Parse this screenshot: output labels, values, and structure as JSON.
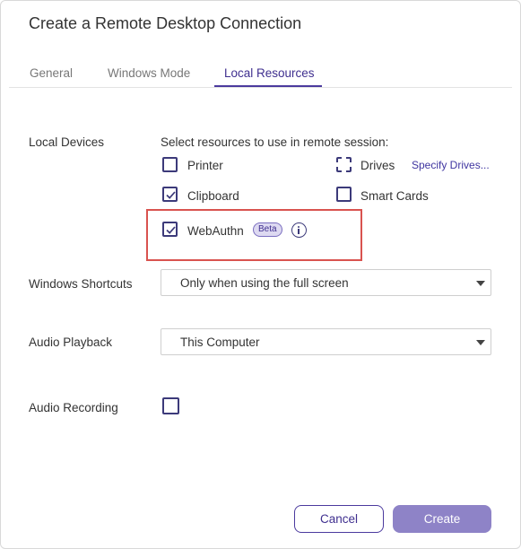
{
  "dialog": {
    "title": "Create a Remote Desktop Connection"
  },
  "tabs": [
    {
      "label": "General",
      "active": false
    },
    {
      "label": "Windows Mode",
      "active": false
    },
    {
      "label": "Local Resources",
      "active": true
    }
  ],
  "local_devices": {
    "label": "Local Devices",
    "instruction": "Select resources to use in remote session:",
    "options": {
      "printer": {
        "label": "Printer",
        "checked": false
      },
      "drives": {
        "label": "Drives",
        "checked": false,
        "link": "Specify Drives..."
      },
      "clipboard": {
        "label": "Clipboard",
        "checked": true
      },
      "smart_cards": {
        "label": "Smart Cards",
        "checked": false
      },
      "webauthn": {
        "label": "WebAuthn",
        "checked": true,
        "badge": "Beta",
        "icon": "info-icon"
      }
    }
  },
  "windows_shortcuts": {
    "label": "Windows Shortcuts",
    "value": "Only when using the full screen"
  },
  "audio_playback": {
    "label": "Audio Playback",
    "value": "This Computer"
  },
  "audio_recording": {
    "label": "Audio Recording",
    "checked": false
  },
  "buttons": {
    "cancel": "Cancel",
    "create": "Create"
  },
  "colors": {
    "accent": "#4b3a9e",
    "create_button": "#8e83c7",
    "highlight": "#d9534f"
  }
}
